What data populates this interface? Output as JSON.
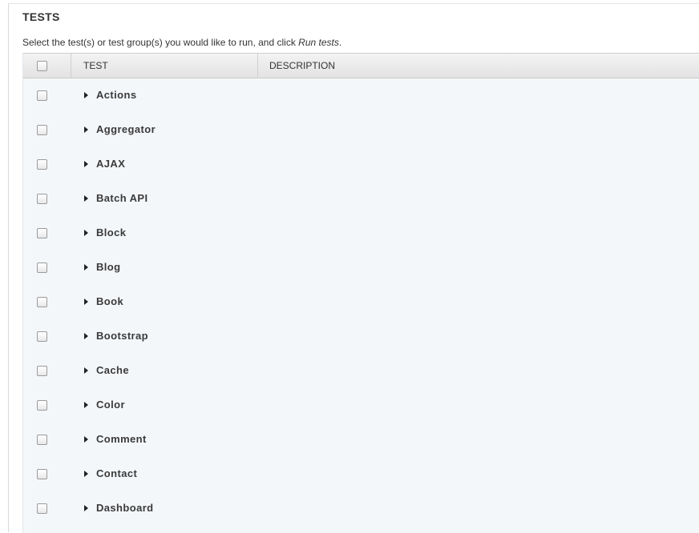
{
  "section": {
    "title": "TESTS",
    "description_prefix": "Select the test(s) or test group(s) you would like to run, and click ",
    "description_emphasis": "Run tests",
    "description_suffix": "."
  },
  "table": {
    "columns": [
      "TEST",
      "DESCRIPTION"
    ],
    "rows": [
      {
        "label": "Actions"
      },
      {
        "label": "Aggregator"
      },
      {
        "label": "AJAX"
      },
      {
        "label": "Batch API"
      },
      {
        "label": "Block"
      },
      {
        "label": "Blog"
      },
      {
        "label": "Book"
      },
      {
        "label": "Bootstrap"
      },
      {
        "label": "Cache"
      },
      {
        "label": "Color"
      },
      {
        "label": "Comment"
      },
      {
        "label": "Contact"
      },
      {
        "label": "Dashboard"
      }
    ]
  }
}
